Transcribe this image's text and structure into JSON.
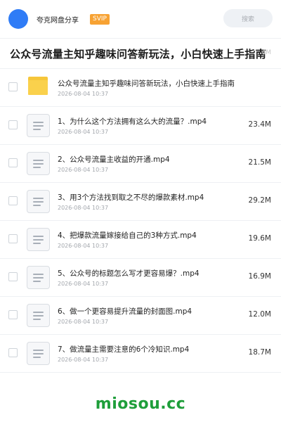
{
  "header": {
    "app_name": "夸克网盘分享",
    "badge": "SVIP",
    "search_placeholder": "搜索"
  },
  "page": {
    "title": "公众号流量主知乎趣味问答新玩法，小白快速上手指南",
    "title_overflow_hint": "4M"
  },
  "files": [
    {
      "type": "folder",
      "name": "公众号流量主知乎趣味问答新玩法，小白快速上手指南",
      "date": "2026-08-04 10:37",
      "size": ""
    },
    {
      "type": "file",
      "name": "1、为什么这个方法拥有这么大的流量？.mp4",
      "date": "2026-08-04 10:37",
      "size": "23.4M"
    },
    {
      "type": "file",
      "name": "2、公众号流量主收益的开通.mp4",
      "date": "2026-08-04 10:37",
      "size": "21.5M"
    },
    {
      "type": "file",
      "name": "3、用3个方法找到取之不尽的爆款素材.mp4",
      "date": "2026-08-04 10:37",
      "size": "29.2M"
    },
    {
      "type": "file",
      "name": "4、把爆款流量嫁接给自己的3种方式.mp4",
      "date": "2026-08-04 10:37",
      "size": "19.6M"
    },
    {
      "type": "file",
      "name": "5、公众号的标题怎么写才更容易爆？.mp4",
      "date": "2026-08-04 10:37",
      "size": "16.9M"
    },
    {
      "type": "file",
      "name": "6、做一个更容易提升流量的封面图.mp4",
      "date": "2026-08-04 10:37",
      "size": "12.0M"
    },
    {
      "type": "file",
      "name": "7、做流量主需要注意的6个冷知识.mp4",
      "date": "2026-08-04 10:37",
      "size": "18.7M"
    }
  ],
  "watermark": "miosou.cc",
  "colors": {
    "avatar": "#2f7cf6",
    "svip_badge": "#f7a233",
    "folder": "#fad14c",
    "watermark": "#1e9e3a"
  }
}
